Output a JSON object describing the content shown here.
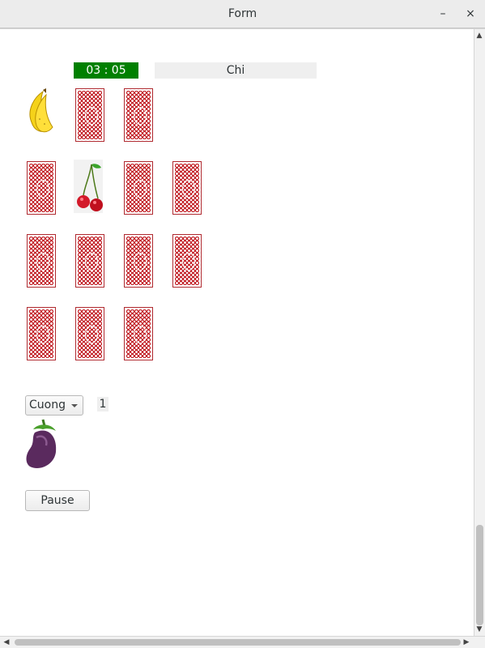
{
  "window": {
    "title": "Form",
    "minimize": "–",
    "close": "×"
  },
  "game": {
    "timer": "03 : 05",
    "current_player": "Chi",
    "card_back_icon": "ornate-card-back",
    "grid": [
      [
        "banana",
        "back",
        "back"
      ],
      [
        "back",
        "cherry",
        "back",
        "back"
      ],
      [
        "back",
        "back",
        "back",
        "back"
      ],
      [
        "back",
        "back",
        "back"
      ]
    ]
  },
  "controls": {
    "player_select": "Cuong",
    "score": "1",
    "last_matched_icon": "eggplant",
    "pause_label": "Pause"
  },
  "colors": {
    "timer_bg": "#008000",
    "card_back": "#c62f35"
  }
}
